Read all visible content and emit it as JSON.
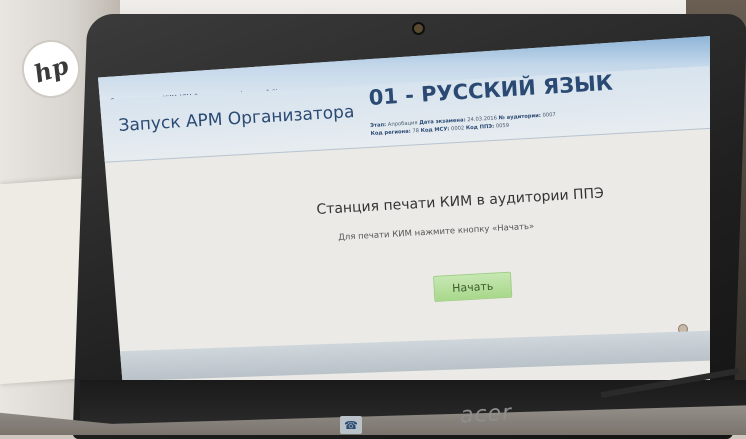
{
  "window": {
    "caption": "Станция печати КИМ АРМ Организатора (версия 1.0)"
  },
  "app": {
    "title": "Запуск АРМ Организатора"
  },
  "exam": {
    "subject": "01 - РУССКИЙ ЯЗЫК",
    "meta_line1_k1": "Этап:",
    "meta_line1_v1": "Апробация",
    "meta_line1_k2": "Дата экзамена:",
    "meta_line1_v2": "24.03.2016",
    "meta_line1_k3": "№ аудитории:",
    "meta_line1_v3": "0007",
    "meta_line2_k1": "Код региона:",
    "meta_line2_v1": "78",
    "meta_line2_k2": "Код МСУ:",
    "meta_line2_v2": "0002",
    "meta_line2_k3": "Код ППЭ:",
    "meta_line2_v3": "0059"
  },
  "station": {
    "title": "Станция печати КИМ в аудитории ППЭ",
    "instruction": "Для печати КИМ нажмите кнопку «Начать»",
    "start_label": "Начать"
  },
  "hardware": {
    "laptop_brand": "acer",
    "bg_brand": "hp"
  },
  "colors": {
    "accent": "#2a4a73",
    "button": "#a8d88b"
  },
  "icons": {
    "taskbar": "network-icon"
  }
}
